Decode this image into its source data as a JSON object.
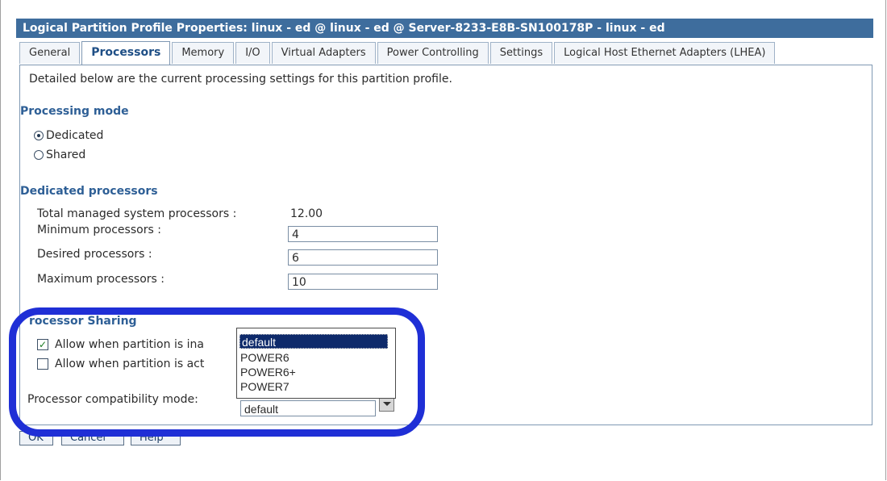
{
  "window": {
    "title": "Logical Partition Profile Properties: linux - ed @ linux - ed @ Server-8233-E8B-SN100178P - linux - ed"
  },
  "tabs": [
    {
      "label": "General"
    },
    {
      "label": "Processors"
    },
    {
      "label": "Memory"
    },
    {
      "label": "I/O"
    },
    {
      "label": "Virtual Adapters"
    },
    {
      "label": "Power Controlling"
    },
    {
      "label": "Settings"
    },
    {
      "label": "Logical Host Ethernet Adapters (LHEA)"
    }
  ],
  "active_tab": "Processors",
  "intro_text": "Detailed below are the current processing settings for this partition profile.",
  "processing_mode": {
    "heading": "Processing mode",
    "options": [
      {
        "label": "Dedicated",
        "selected": true
      },
      {
        "label": "Shared",
        "selected": false
      }
    ]
  },
  "dedicated_processors": {
    "heading": "Dedicated processors",
    "total_label": "Total managed system processors :",
    "total_value": "12.00",
    "minimum_label": "Minimum processors :",
    "minimum_value": "4",
    "desired_label": "Desired processors :",
    "desired_value": "6",
    "maximum_label": "Maximum processors :",
    "maximum_value": "10"
  },
  "processor_sharing": {
    "heading": "rocessor Sharing",
    "inactive_label": "Allow when partition is ina",
    "inactive_checked": true,
    "active_label": "Allow when partition is act",
    "active_checked": false
  },
  "compatibility": {
    "label": "Processor compatibility mode:",
    "value": "default",
    "options": [
      "default",
      "POWER6",
      "POWER6+",
      "POWER7"
    ],
    "selected_option": "default"
  },
  "buttons": {
    "ok": "OK",
    "cancel": "Cancel",
    "help": "Help"
  },
  "colors": {
    "title_bar": "#3e6d9d",
    "heading": "#2e5f96",
    "highlight": "#1f2fd6",
    "selected_option": "#0e2a6b"
  }
}
